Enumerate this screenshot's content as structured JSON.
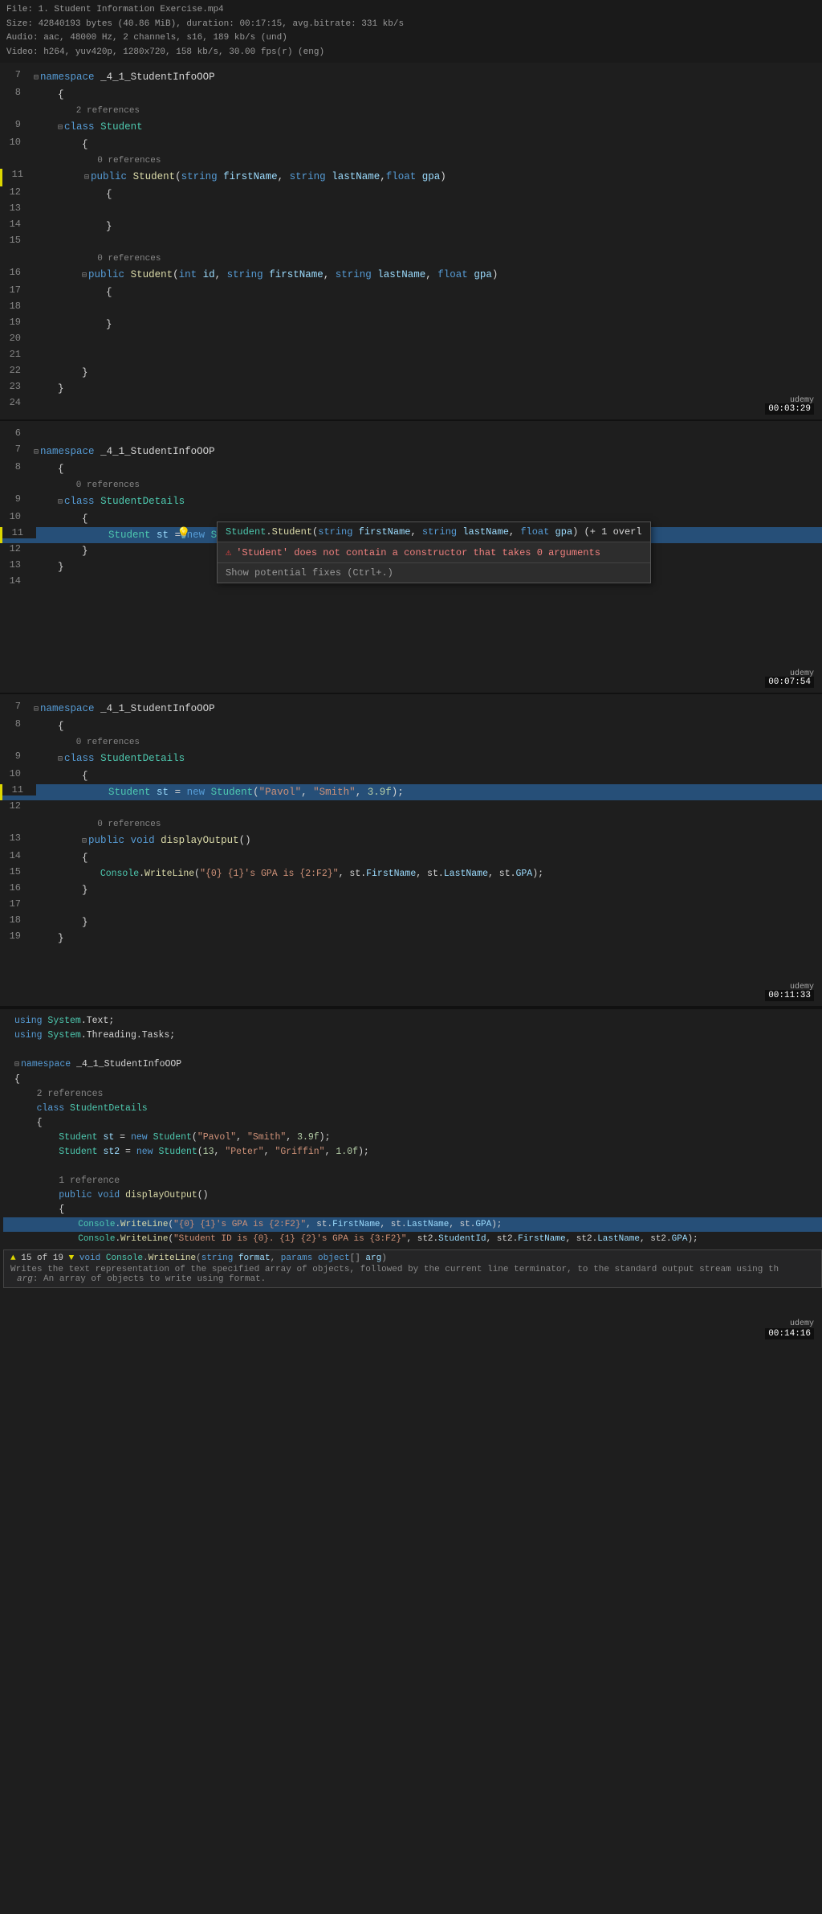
{
  "fileInfo": {
    "line1": "File: 1. Student Information Exercise.mp4",
    "line2": "Size: 42840193 bytes (40.86 MiB), duration: 00:17:15, avg.bitrate: 331 kb/s",
    "line3": "  Audio: aac, 48000 Hz, 2 channels, s16, 189 kb/s (und)",
    "line4": "  Video: h264, yuv420p, 1280x720, 158 kb/s, 30.00 fps(r) (eng)"
  },
  "panels": [
    {
      "id": "panel1",
      "timestamp": "00:03:29",
      "lines": [
        {
          "num": "7",
          "indent": 0,
          "content": "namespace _4_1_StudentInfoOOP",
          "collapse": true
        },
        {
          "num": "8",
          "indent": 1,
          "content": "{"
        },
        {
          "num": "",
          "indent": 2,
          "refs": "2 references"
        },
        {
          "num": "9",
          "indent": 2,
          "content": "class Student",
          "collapse": true
        },
        {
          "num": "10",
          "indent": 2,
          "content": "{"
        },
        {
          "num": "",
          "indent": 3,
          "refs": "0 references"
        },
        {
          "num": "11",
          "indent": 3,
          "content": "public Student(string firstName, string lastName,float gpa)",
          "collapse": true,
          "yellowBorder": true
        },
        {
          "num": "12",
          "indent": 3,
          "content": "{"
        },
        {
          "num": "13",
          "indent": 3,
          "content": ""
        },
        {
          "num": "14",
          "indent": 3,
          "content": "}"
        },
        {
          "num": "15",
          "indent": 3,
          "content": ""
        },
        {
          "num": "",
          "indent": 3,
          "refs": "0 references"
        },
        {
          "num": "16",
          "indent": 3,
          "content": "public Student(int id, string firstName, string lastName, float gpa)",
          "collapse": true
        },
        {
          "num": "17",
          "indent": 3,
          "content": "{"
        },
        {
          "num": "18",
          "indent": 3,
          "content": ""
        },
        {
          "num": "19",
          "indent": 3,
          "content": "}"
        },
        {
          "num": "20",
          "indent": 3,
          "content": ""
        },
        {
          "num": "21",
          "indent": 3,
          "content": ""
        },
        {
          "num": "22",
          "indent": 2,
          "content": "}"
        },
        {
          "num": "23",
          "indent": 1,
          "content": "}"
        },
        {
          "num": "24",
          "indent": 0,
          "content": ""
        }
      ]
    },
    {
      "id": "panel2",
      "timestamp": "00:07:54",
      "popup": true,
      "lines": [
        {
          "num": "6",
          "indent": 0,
          "content": ""
        },
        {
          "num": "7",
          "indent": 0,
          "content": "namespace _4_1_StudentInfoOOP",
          "collapse": true
        },
        {
          "num": "8",
          "indent": 1,
          "content": "{"
        },
        {
          "num": "",
          "indent": 2,
          "refs": "0 references"
        },
        {
          "num": "9",
          "indent": 2,
          "content": "class StudentDetails",
          "collapse": true
        },
        {
          "num": "10",
          "indent": 2,
          "content": "{"
        },
        {
          "num": "11",
          "indent": 3,
          "content": "Student st = new Student();",
          "highlight": true,
          "yellowBorder": true
        },
        {
          "num": "12",
          "indent": 3,
          "content": "}"
        },
        {
          "num": "13",
          "indent": 2,
          "content": "}"
        },
        {
          "num": "14",
          "indent": 1,
          "content": ""
        }
      ],
      "popupData": {
        "method": "Student.Student(string firstName, string lastName, float gpa) (+ 1 overl",
        "error": "'Student' does not contain a constructor that takes 0 arguments",
        "fix": "Show potential fixes",
        "fixShortcut": "(Ctrl+.)"
      }
    },
    {
      "id": "panel3",
      "timestamp": "00:11:33",
      "lines": [
        {
          "num": "7",
          "indent": 0,
          "content": "namespace _4_1_StudentInfoOOP",
          "collapse": true
        },
        {
          "num": "8",
          "indent": 1,
          "content": "{"
        },
        {
          "num": "",
          "indent": 2,
          "refs": "0 references"
        },
        {
          "num": "9",
          "indent": 2,
          "content": "class StudentDetails",
          "collapse": true
        },
        {
          "num": "10",
          "indent": 2,
          "content": "{"
        },
        {
          "num": "11",
          "indent": 3,
          "content": "Student st = new Student(\"Pavol\", \"Smith\", 3.9f);",
          "highlight": true,
          "yellowBorder": true
        },
        {
          "num": "12",
          "indent": 3,
          "content": ""
        },
        {
          "num": "",
          "indent": 3,
          "refs": "0 references"
        },
        {
          "num": "13",
          "indent": 3,
          "content": "public void displayOutput()",
          "collapse": true
        },
        {
          "num": "14",
          "indent": 3,
          "content": "{"
        },
        {
          "num": "15",
          "indent": 4,
          "content": "Console.WriteLine(\"{0} {1}'s GPA is {2:F2}\", st.FirstName, st.LastName, st.GPA);"
        },
        {
          "num": "16",
          "indent": 3,
          "content": "}"
        },
        {
          "num": "17",
          "indent": 2,
          "content": ""
        },
        {
          "num": "18",
          "indent": 2,
          "content": "}"
        },
        {
          "num": "19",
          "indent": 1,
          "content": ""
        }
      ]
    }
  ],
  "terminal": {
    "timestamp": "00:14:16",
    "lines": [
      {
        "content": "using System.Text;"
      },
      {
        "content": "using System.Threading.Tasks;"
      },
      {
        "content": ""
      },
      {
        "collapse": true,
        "content": "namespace _4_1_StudentInfoOOP"
      },
      {
        "content": "{"
      },
      {
        "indent": 1,
        "refs": "2 references"
      },
      {
        "indent": 1,
        "content": "class StudentDetails"
      },
      {
        "indent": 1,
        "content": "{"
      },
      {
        "indent": 2,
        "content": "Student st = new Student(\"Pavol\", \"Smith\", 3.9f);"
      },
      {
        "indent": 2,
        "content": "Student st2 = new Student(13, \"Peter\", \"Griffin\", 1.0f);"
      },
      {
        "indent": 2,
        "content": ""
      },
      {
        "indent": 2,
        "refs": "1 reference"
      },
      {
        "indent": 2,
        "content": "public void displayOutput()"
      },
      {
        "indent": 2,
        "content": "{"
      },
      {
        "indent": 3,
        "content": "Console.WriteLine(\"{0} {1}'s GPA is {2:F2}\", st.FirstName, st.LastName, st.GPA);",
        "highlight": true
      },
      {
        "indent": 3,
        "content": "Console.WriteLine(\"Student ID is {0}. {1} {2}'s GPA is {3:F2}\", st2.StudentId, st2.FirstName, st2.LastName, st2.GPA);"
      }
    ],
    "tooltip": {
      "line": "▲ 15 of 19 ▼  void Console.WriteLine(string format, params object[] arg)",
      "desc1": "Writes the text representation of the specified array of objects, followed by the current line terminator, to the standard output stream using th",
      "desc2": "    arg: An array of objects to write using format."
    }
  }
}
